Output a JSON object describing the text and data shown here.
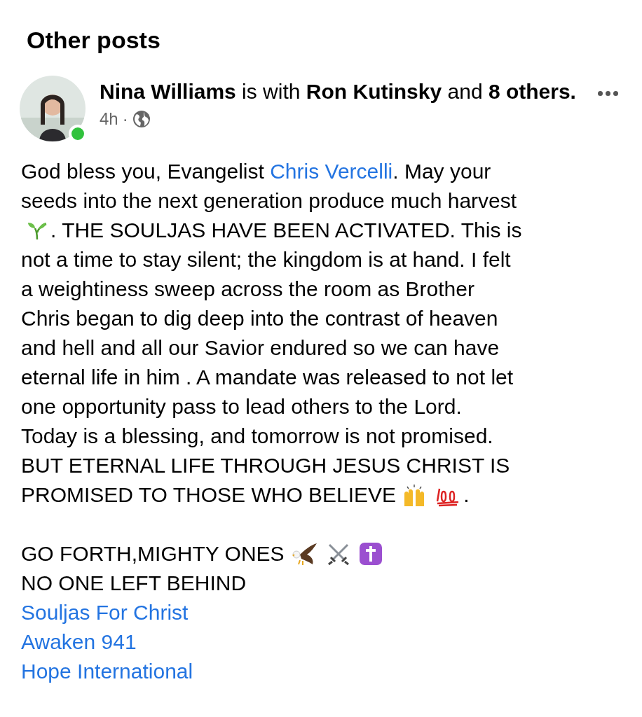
{
  "section_title": "Other posts",
  "post": {
    "author_line": "**Nina Williams** is with **Ron Kutinsky** and **8 others.**",
    "online": true,
    "time": "4h",
    "separator": "·",
    "paragraphs": [
      [
        [
          {
            "kind": "text",
            "text": "God bless you, Evangelist "
          },
          {
            "kind": "link",
            "text": "Chris Vercelli"
          },
          {
            "kind": "text",
            "text": ". May your"
          }
        ],
        [
          {
            "kind": "text",
            "text": "seeds into the next generation produce much harvest"
          }
        ],
        [
          {
            "kind": "emoji"
          },
          {
            "kind": "text",
            "text": ". THE SOULJAS HAVE BEEN ACTIVATED. This is"
          }
        ],
        [
          {
            "kind": "text",
            "text": "not a time to stay silent; the kingdom is at hand. I felt"
          }
        ],
        [
          {
            "kind": "text",
            "text": "a weightiness sweep across the room as Brother"
          }
        ],
        [
          {
            "kind": "text",
            "text": "Chris began to dig deep into the contrast of heaven"
          }
        ],
        [
          {
            "kind": "text",
            "text": "and hell and all our Savior endured so we can have"
          }
        ],
        [
          {
            "kind": "text",
            "text": "eternal life in him . A mandate was released to not let"
          }
        ],
        [
          {
            "kind": "text",
            "text": "one opportunity pass to lead others to the Lord."
          }
        ],
        [
          {
            "kind": "text",
            "text": "Today is a blessing, and tomorrow is not promised."
          }
        ],
        [
          {
            "kind": "text",
            "text": "BUT ETERNAL LIFE THROUGH JESUS CHRIST IS"
          }
        ],
        [
          {
            "kind": "text",
            "text": "PROMISED TO THOSE WHO BELIEVE"
          },
          {
            "kind": "emoji"
          },
          {
            "kind": "emoji"
          },
          {
            "kind": "text",
            "text": "."
          }
        ]
      ],
      [
        [
          {
            "kind": "text",
            "text": "GO FORTH,MIGHTY ONES"
          },
          {
            "kind": "emoji"
          },
          {
            "kind": "emoji"
          },
          {
            "kind": "emoji"
          }
        ],
        [
          {
            "kind": "text",
            "text": "NO ONE LEFT BEHIND"
          }
        ],
        [
          {
            "kind": "link",
            "text": "Souljas For Christ"
          }
        ],
        [
          {
            "kind": "link",
            "text": "Awaken 941"
          }
        ],
        [
          {
            "kind": "link",
            "text": "Hope International"
          }
        ]
      ]
    ]
  }
}
